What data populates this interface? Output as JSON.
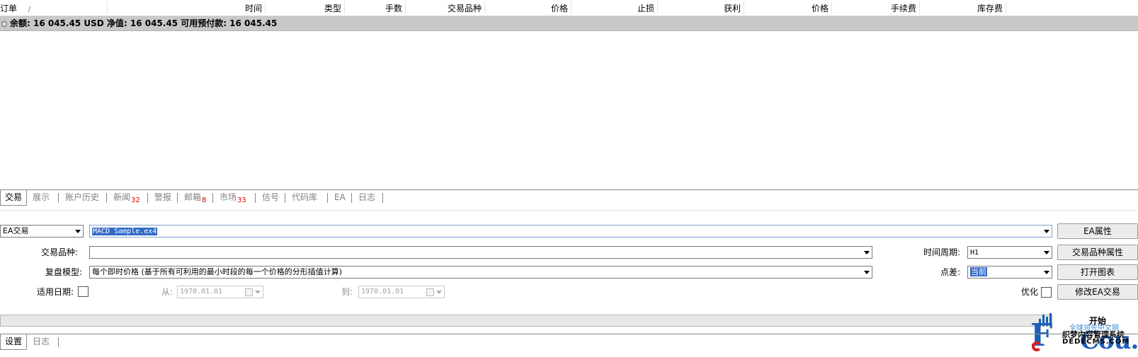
{
  "orders_table": {
    "columns": [
      "订单",
      "时间",
      "类型",
      "手数",
      "交易品种",
      "价格",
      "止损",
      "获利",
      "价格",
      "手续费",
      "库存费"
    ],
    "sort_indicator": "/"
  },
  "balance": {
    "text": "余额: 16 045.45 USD  净值: 16 045.45  可用预付款: 16 045.45"
  },
  "terminal_tabs": [
    {
      "label": "交易",
      "badge": ""
    },
    {
      "label": "展示",
      "badge": ""
    },
    {
      "label": "账户历史",
      "badge": ""
    },
    {
      "label": "新闻",
      "badge": "32"
    },
    {
      "label": "警报",
      "badge": ""
    },
    {
      "label": "邮箱",
      "badge": "8"
    },
    {
      "label": "市场",
      "badge": "33"
    },
    {
      "label": "信号",
      "badge": ""
    },
    {
      "label": "代码库",
      "badge": ""
    },
    {
      "label": "EA",
      "badge": ""
    },
    {
      "label": "日志",
      "badge": ""
    }
  ],
  "tester": {
    "mode_select": "EA交易",
    "ea_file": "MACD Sample.ex4",
    "symbol_label": "交易品种:",
    "symbol_value": "",
    "model_label": "复盘模型:",
    "model_value": "每个即时价格 (基于所有可利用的最小时段的每一个价格的分形插值计算)",
    "use_date_label": "适用日期:",
    "from_label": "从:",
    "from_date": "1970.01.01",
    "to_label": "到:",
    "to_date": "1970.01.01",
    "period_label": "时间周期:",
    "period_value": "H1",
    "spread_label": "点差:",
    "spread_value": "当前",
    "optimize_label": "优化",
    "progress": 0,
    "buttons": {
      "ea_props": "EA属性",
      "symbol_props": "交易品种属性",
      "open_chart": "打开图表",
      "modify_ea": "修改EA交易",
      "start": "开始"
    }
  },
  "tester_tabs": [
    {
      "label": "设置"
    },
    {
      "label": "日志"
    }
  ],
  "watermark": {
    "line1": "全球领先中文网",
    "line2": "织梦内容管理系统",
    "line3": "DEDECMS.COM",
    "big_letter": "F",
    "big_word": "Cou.com"
  },
  "colors": {
    "selection": "#3169c6",
    "badge_red": "#e00000",
    "balance_bar": "#c8c8c8",
    "watermark_blue": "#1c5fb8"
  }
}
